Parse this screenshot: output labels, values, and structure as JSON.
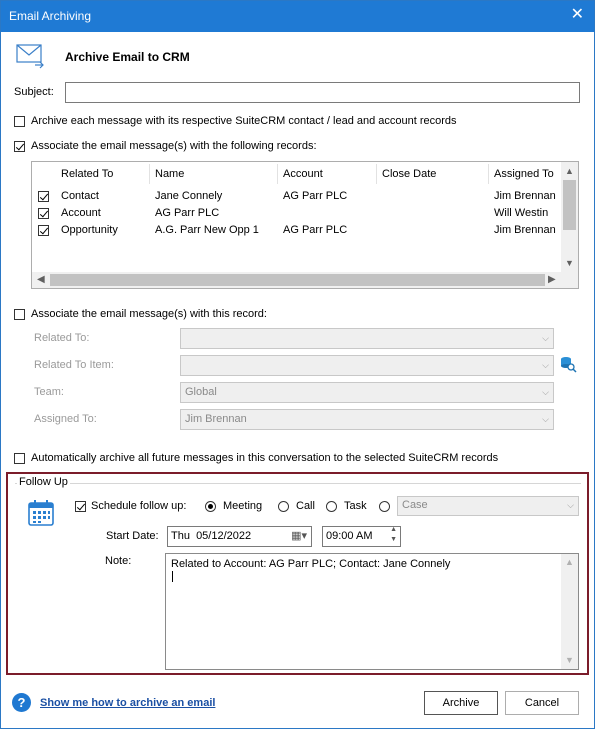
{
  "window": {
    "title": "Email Archiving",
    "close": "✕"
  },
  "header": {
    "title": "Archive Email to CRM"
  },
  "subject": {
    "label": "Subject:",
    "value": ""
  },
  "options": {
    "archive_each": "Archive each message with its respective SuiteCRM contact / lead and account records",
    "associate_records": "Associate the email message(s) with the following records:",
    "associate_this": "Associate the email message(s) with this record:",
    "auto_archive": "Automatically archive all future messages in this conversation to the selected SuiteCRM records"
  },
  "grid": {
    "columns": [
      "Related To",
      "Name",
      "Account",
      "Close Date",
      "Assigned To"
    ],
    "rows": [
      {
        "related": "Contact",
        "name": "Jane Connely",
        "account": "AG Parr PLC",
        "close": "",
        "assigned": "Jim Brennan"
      },
      {
        "related": "Account",
        "name": "AG Parr PLC",
        "account": "",
        "close": "",
        "assigned": "Will Westin"
      },
      {
        "related": "Opportunity",
        "name": "A.G. Parr New Opp 1",
        "account": "AG Parr PLC",
        "close": "",
        "assigned": "Jim Brennan"
      }
    ]
  },
  "record": {
    "related_to_label": "Related To:",
    "related_item_label": "Related To Item:",
    "team_label": "Team:",
    "team_value": "Global",
    "assigned_label": "Assigned To:",
    "assigned_value": "Jim Brennan"
  },
  "followup": {
    "legend": "Follow Up",
    "schedule_label": "Schedule follow up:",
    "meeting": "Meeting",
    "call": "Call",
    "task": "Task",
    "case": "Case",
    "start_label": "Start Date:",
    "date_value": "Thu  05/12/2022",
    "time_value": "09:00 AM",
    "note_label": "Note:",
    "note_value": "Related to Account: AG Parr PLC; Contact: Jane Connely"
  },
  "footer": {
    "help_link": "Show me how to archive an email",
    "archive_button": "Archive",
    "cancel_button": "Cancel"
  },
  "colors": {
    "titlebar": "#1f7ad4",
    "followup_border": "#7b1c2a",
    "link": "#1a4fa3"
  }
}
